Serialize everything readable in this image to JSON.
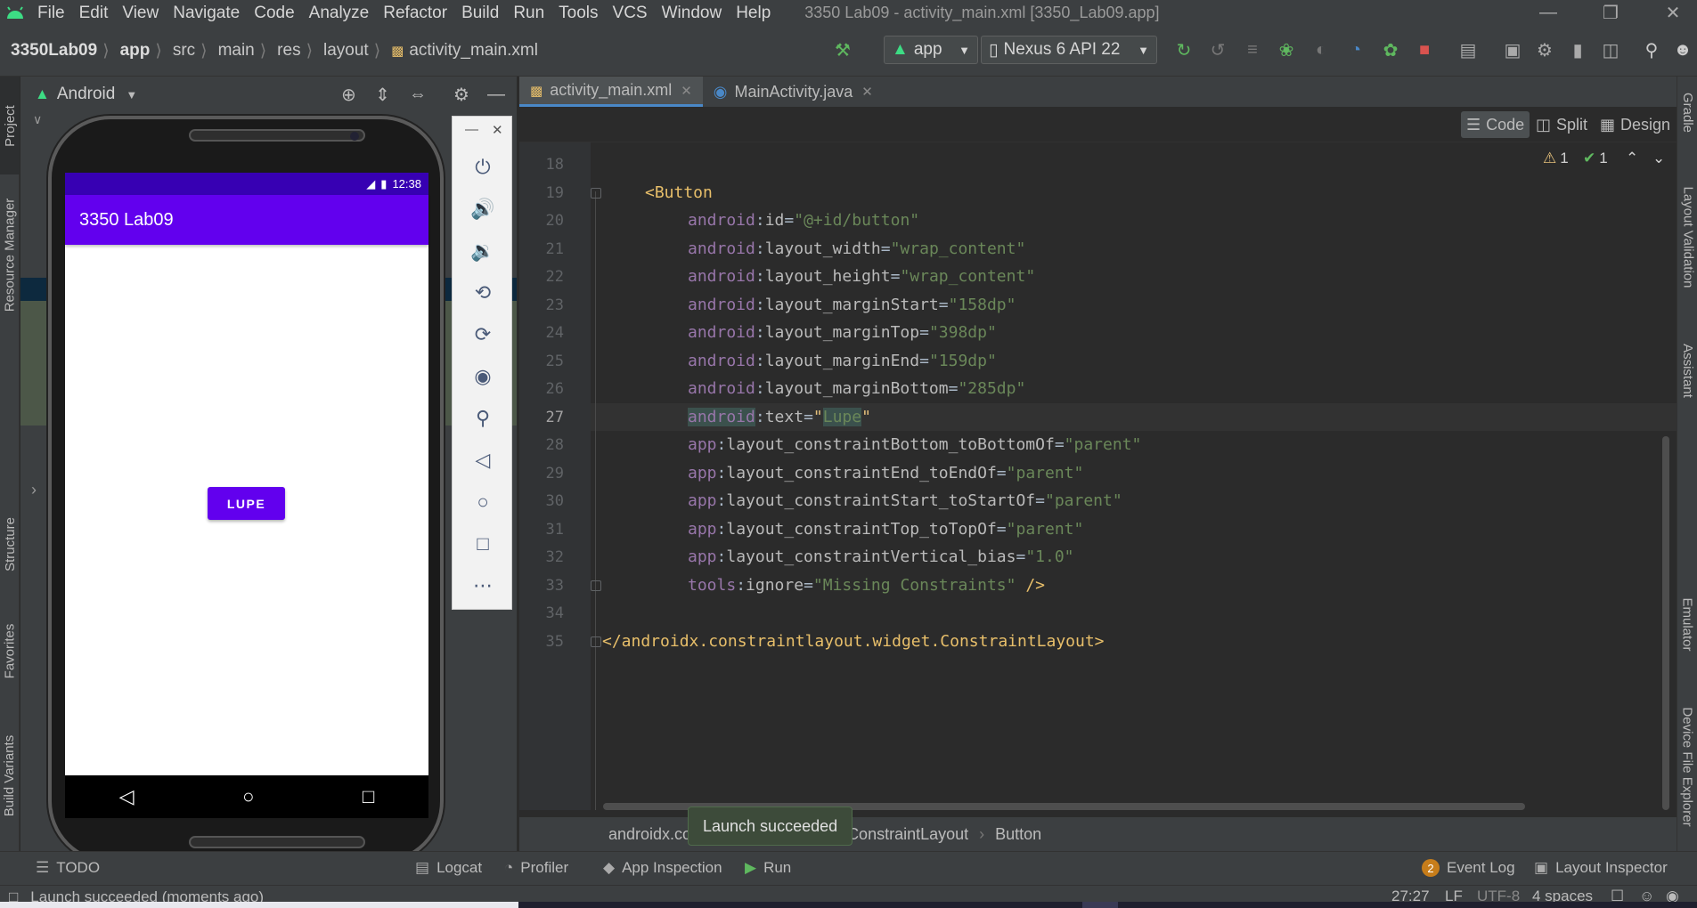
{
  "menu": {
    "items": [
      "File",
      "Edit",
      "View",
      "Navigate",
      "Code",
      "Analyze",
      "Refactor",
      "Build",
      "Run",
      "Tools",
      "VCS",
      "Window",
      "Help"
    ],
    "window_title": "3350 Lab09 - activity_main.xml [3350_Lab09.app]"
  },
  "nav": {
    "crumbs": [
      "3350Lab09",
      "app",
      "src",
      "main",
      "res",
      "layout",
      "activity_main.xml"
    ],
    "run_config": "app",
    "device": "Nexus 6 API 22"
  },
  "left_stripe": {
    "tabs": [
      "Project",
      "Resource Manager",
      "Structure",
      "Favorites",
      "Build Variants"
    ]
  },
  "right_stripe": {
    "tabs": [
      "Gradle",
      "Layout Validation",
      "Assistant",
      "Emulator",
      "Device File Explorer"
    ]
  },
  "project_panel": {
    "view_mode": "Android"
  },
  "emulator": {
    "status_time": "12:38",
    "app_title": "3350 Lab09",
    "button_text": "LUPE"
  },
  "editor": {
    "tabs": [
      {
        "label": "activity_main.xml",
        "active": true
      },
      {
        "label": "MainActivity.java",
        "active": false
      }
    ],
    "view_modes": [
      "Code",
      "Split",
      "Design"
    ],
    "warnings": "1",
    "ok": "1",
    "line_numbers": [
      "18",
      "19",
      "20",
      "21",
      "22",
      "23",
      "24",
      "25",
      "26",
      "27",
      "28",
      "29",
      "30",
      "31",
      "32",
      "33",
      "34",
      "35"
    ],
    "current_line": "27",
    "code": {
      "l19": "<Button",
      "l20": {
        "ns": "android",
        "attr": "id",
        "val": "\"@+id/button\""
      },
      "l21": {
        "ns": "android",
        "attr": "layout_width",
        "val": "\"wrap_content\""
      },
      "l22": {
        "ns": "android",
        "attr": "layout_height",
        "val": "\"wrap_content\""
      },
      "l23": {
        "ns": "android",
        "attr": "layout_marginStart",
        "val": "\"158dp\""
      },
      "l24": {
        "ns": "android",
        "attr": "layout_marginTop",
        "val": "\"398dp\""
      },
      "l25": {
        "ns": "android",
        "attr": "layout_marginEnd",
        "val": "\"159dp\""
      },
      "l26": {
        "ns": "android",
        "attr": "layout_marginBottom",
        "val": "\"285dp\""
      },
      "l27": {
        "ns": "android",
        "attr": "text",
        "val": "Lupe"
      },
      "l28": {
        "ns": "app",
        "attr": "layout_constraintBottom_toBottomOf",
        "val": "\"parent\""
      },
      "l29": {
        "ns": "app",
        "attr": "layout_constraintEnd_toEndOf",
        "val": "\"parent\""
      },
      "l30": {
        "ns": "app",
        "attr": "layout_constraintStart_toStartOf",
        "val": "\"parent\""
      },
      "l31": {
        "ns": "app",
        "attr": "layout_constraintTop_toTopOf",
        "val": "\"parent\""
      },
      "l32": {
        "ns": "app",
        "attr": "layout_constraintVertical_bias",
        "val": "\"1.0\""
      },
      "l33": {
        "ns": "tools",
        "attr": "ignore",
        "val": "\"Missing Constraints\"",
        "end": " />"
      },
      "l35": "</androidx.constraintlayout.widget.ConstraintLayout>"
    },
    "breadcrumb": [
      "androidx.co",
      "ConstraintLayout",
      "Button"
    ],
    "tooltip": "Launch succeeded"
  },
  "tool_windows": {
    "todo": "TODO",
    "logcat": "Logcat",
    "profiler": "Profiler",
    "app_inspection": "App Inspection",
    "run": "Run",
    "event_log": "Event Log",
    "event_log_count": "2",
    "layout_inspector": "Layout Inspector"
  },
  "status": {
    "message": "Launch succeeded (moments ago)",
    "position": "27:27",
    "line_sep": "LF",
    "encoding": "UTF-8",
    "indent": "4 spaces"
  },
  "colors": {
    "accent": "#6200ee",
    "status_bar": "#3700b3",
    "xml_tag": "#e8bf6a",
    "xml_ns": "#9876aa",
    "xml_string": "#6a8759"
  }
}
